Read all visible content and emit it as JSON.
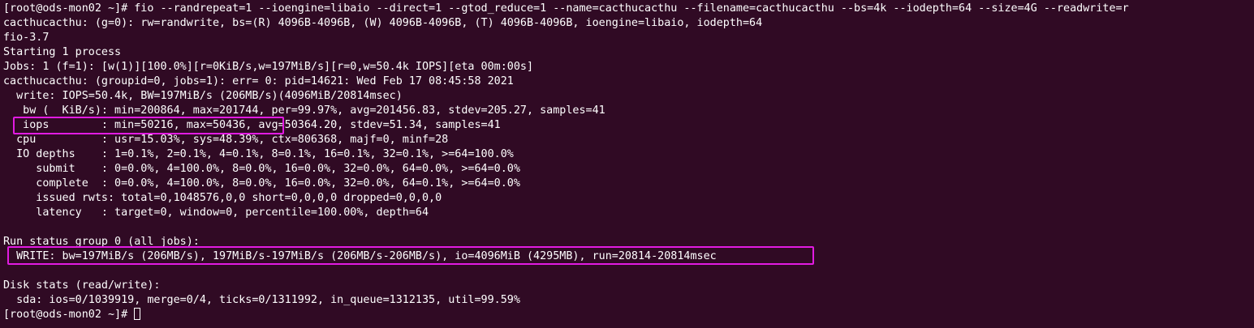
{
  "colors": {
    "background": "#300a24",
    "text": "#ffffff",
    "highlight": "#e21be2"
  },
  "lines": [
    "[root@ods-mon02 ~]# fio --randrepeat=1 --ioengine=libaio --direct=1 --gtod_reduce=1 --name=cacthucacthu --filename=cacthucacthu --bs=4k --iodepth=64 --size=4G --readwrite=r",
    "cacthucacthu: (g=0): rw=randwrite, bs=(R) 4096B-4096B, (W) 4096B-4096B, (T) 4096B-4096B, ioengine=libaio, iodepth=64",
    "fio-3.7",
    "Starting 1 process",
    "Jobs: 1 (f=1): [w(1)][100.0%][r=0KiB/s,w=197MiB/s][r=0,w=50.4k IOPS][eta 00m:00s]",
    "cacthucacthu: (groupid=0, jobs=1): err= 0: pid=14621: Wed Feb 17 08:45:58 2021",
    "  write: IOPS=50.4k, BW=197MiB/s (206MB/s)(4096MiB/20814msec)",
    "   bw (  KiB/s): min=200864, max=201744, per=99.97%, avg=201456.83, stdev=205.27, samples=41",
    "   iops        : min=50216, max=50436, avg=50364.20, stdev=51.34, samples=41",
    "  cpu          : usr=15.03%, sys=48.39%, ctx=806368, majf=0, minf=28",
    "  IO depths    : 1=0.1%, 2=0.1%, 4=0.1%, 8=0.1%, 16=0.1%, 32=0.1%, >=64=100.0%",
    "     submit    : 0=0.0%, 4=100.0%, 8=0.0%, 16=0.0%, 32=0.0%, 64=0.0%, >=64=0.0%",
    "     complete  : 0=0.0%, 4=100.0%, 8=0.0%, 16=0.0%, 32=0.0%, 64=0.1%, >=64=0.0%",
    "     issued rwts: total=0,1048576,0,0 short=0,0,0,0 dropped=0,0,0,0",
    "     latency   : target=0, window=0, percentile=100.00%, depth=64",
    "",
    "Run status group 0 (all jobs):",
    "  WRITE: bw=197MiB/s (206MB/s), 197MiB/s-197MiB/s (206MB/s-206MB/s), io=4096MiB (4295MB), run=20814-20814msec",
    "",
    "Disk stats (read/write):",
    "  sda: ios=0/1039919, merge=0/4, ticks=0/1311992, in_queue=1312135, util=99.59%"
  ],
  "prompt": "[root@ods-mon02 ~]# "
}
